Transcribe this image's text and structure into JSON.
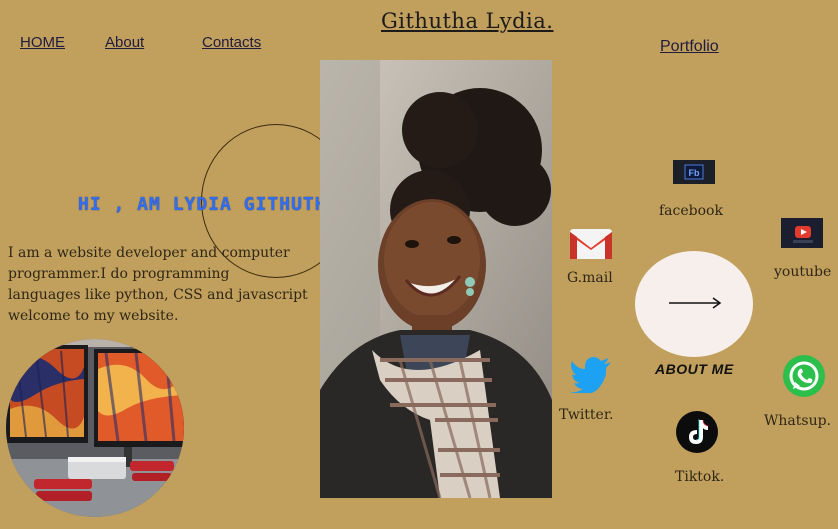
{
  "nav": {
    "home": "HOME",
    "about": "About",
    "contacts": "Contacts"
  },
  "site_title": "Githutha Lydia.",
  "portfolio_label": "Portfolio",
  "hero": {
    "greeting": "HI , AM LYDIA GITHUTHA .",
    "intro_lines": [
      "I am a website developer and computer",
      "programmer.I do programming",
      "languages like python, CSS and javascript",
      "welcome to my website."
    ]
  },
  "social": {
    "facebook": {
      "label": "facebook",
      "icon": "facebook-icon",
      "glyph": "Fb"
    },
    "gmail": {
      "label": "G.mail",
      "icon": "gmail-icon"
    },
    "youtube": {
      "label": "youtube",
      "icon": "youtube-icon"
    },
    "twitter": {
      "label": "Twitter.",
      "icon": "twitter-icon"
    },
    "whatsapp": {
      "label": "Whatsup.",
      "icon": "whatsapp-icon"
    },
    "tiktok": {
      "label": "Tiktok.",
      "icon": "tiktok-icon"
    }
  },
  "about_me": {
    "label": "ABOUT ME",
    "arrow_icon": "arrow-right-icon"
  },
  "colors": {
    "background": "#c19f5c",
    "greeting": "#2f6df2",
    "nav_link": "#1f1c3e",
    "about_circle": "#f7efec"
  }
}
